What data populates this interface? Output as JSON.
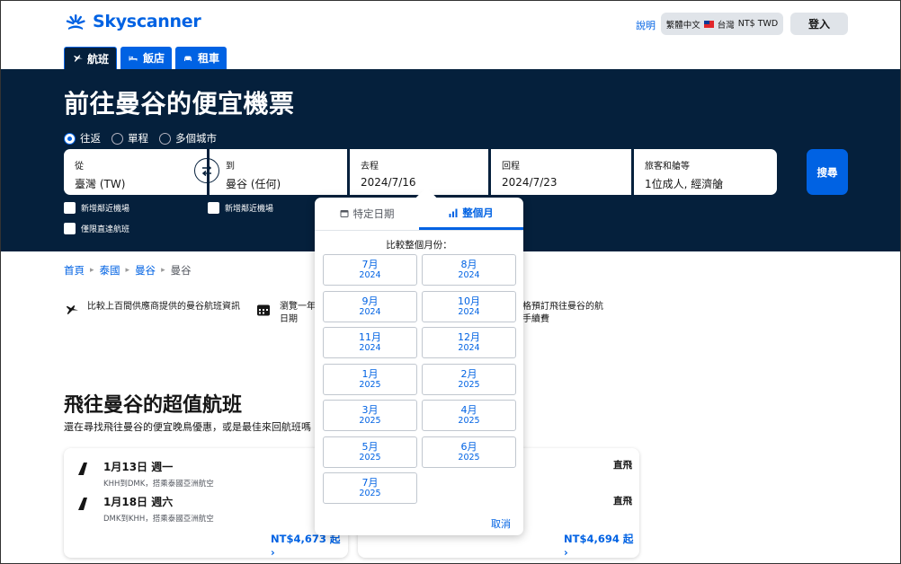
{
  "brand": {
    "name": "Skyscanner",
    "color": "#0062e3"
  },
  "header": {
    "help": "說明",
    "locale": {
      "language": "繁體中文",
      "region": "台灣",
      "currency": "NT$ TWD"
    },
    "login": "登入"
  },
  "tabs": [
    {
      "label": "航班",
      "icon": "plane-icon",
      "active": true
    },
    {
      "label": "飯店",
      "icon": "bed-icon",
      "active": false
    },
    {
      "label": "租車",
      "icon": "car-icon",
      "active": false
    }
  ],
  "hero": {
    "title": "前往曼谷的便宜機票",
    "trip_types": [
      "往返",
      "單程",
      "多個城市"
    ],
    "selected_trip_type": "往返"
  },
  "search": {
    "from_label": "從",
    "from_value": "臺灣 (TW)",
    "to_label": "到",
    "to_value": "曼谷 (任何)",
    "depart_label": "去程",
    "depart_value": "2024/7/16",
    "return_label": "回程",
    "return_value": "2024/7/23",
    "travellers_label": "旅客和艙等",
    "travellers_value": "1位成人, 經濟艙",
    "search_button": "搜尋",
    "nearby_from": "新增鄰近機場",
    "nearby_to": "新增鄰近機場",
    "direct_only": "僅限直達航班"
  },
  "breadcrumb": [
    "首頁",
    "泰國",
    "曼谷",
    "曼谷"
  ],
  "features": [
    {
      "icon": "plane-icon",
      "text": "比較上百間供應商提供的曼谷航班資訊"
    },
    {
      "icon": "calendar-icon",
      "text": "瀏覽一年(\n日期"
    },
    {
      "icon": "tag-icon",
      "text": "格預訂飛往曼谷的航\n手續費"
    }
  ],
  "deals": {
    "title": "飛往曼谷的超值航班",
    "subtitle": "還在尋找飛往曼谷的便宜晚鳥優惠，或是最佳來回航班嗎",
    "cards": [
      {
        "flights": [
          {
            "date": "1月13日 週一",
            "route": "KHH到DMK，搭乘泰國亞洲航空",
            "type": "直飛"
          },
          {
            "date": "1月18日 週六",
            "route": "DMK到KHH，搭乘泰國亞洲航空",
            "type": "直飛"
          }
        ],
        "price": "NT$4,673 起 ›"
      },
      {
        "flights": [
          {
            "date": "",
            "route": "",
            "type": "直飛"
          },
          {
            "date": "",
            "route": "",
            "type": "直飛"
          }
        ],
        "price": "NT$4,694 起 ›"
      }
    ]
  },
  "date_popover": {
    "tabs": [
      {
        "label": "特定日期",
        "icon": "calendar-icon",
        "active": false
      },
      {
        "label": "整個月",
        "icon": "bar-chart-icon",
        "active": true
      }
    ],
    "compare_label": "比較整個月份：",
    "months": [
      {
        "month": "7月",
        "year": "2024"
      },
      {
        "month": "8月",
        "year": "2024"
      },
      {
        "month": "9月",
        "year": "2024"
      },
      {
        "month": "10月",
        "year": "2024"
      },
      {
        "month": "11月",
        "year": "2024"
      },
      {
        "month": "12月",
        "year": "2024"
      },
      {
        "month": "1月",
        "year": "2025"
      },
      {
        "month": "2月",
        "year": "2025"
      },
      {
        "month": "3月",
        "year": "2025"
      },
      {
        "month": "4月",
        "year": "2025"
      },
      {
        "month": "5月",
        "year": "2025"
      },
      {
        "month": "6月",
        "year": "2025"
      },
      {
        "month": "7月",
        "year": "2025"
      }
    ],
    "cancel": "取消"
  },
  "colors": {
    "hero_bg": "#05203c",
    "primary": "#0062e3",
    "button_gray": "#e0e4e9"
  }
}
